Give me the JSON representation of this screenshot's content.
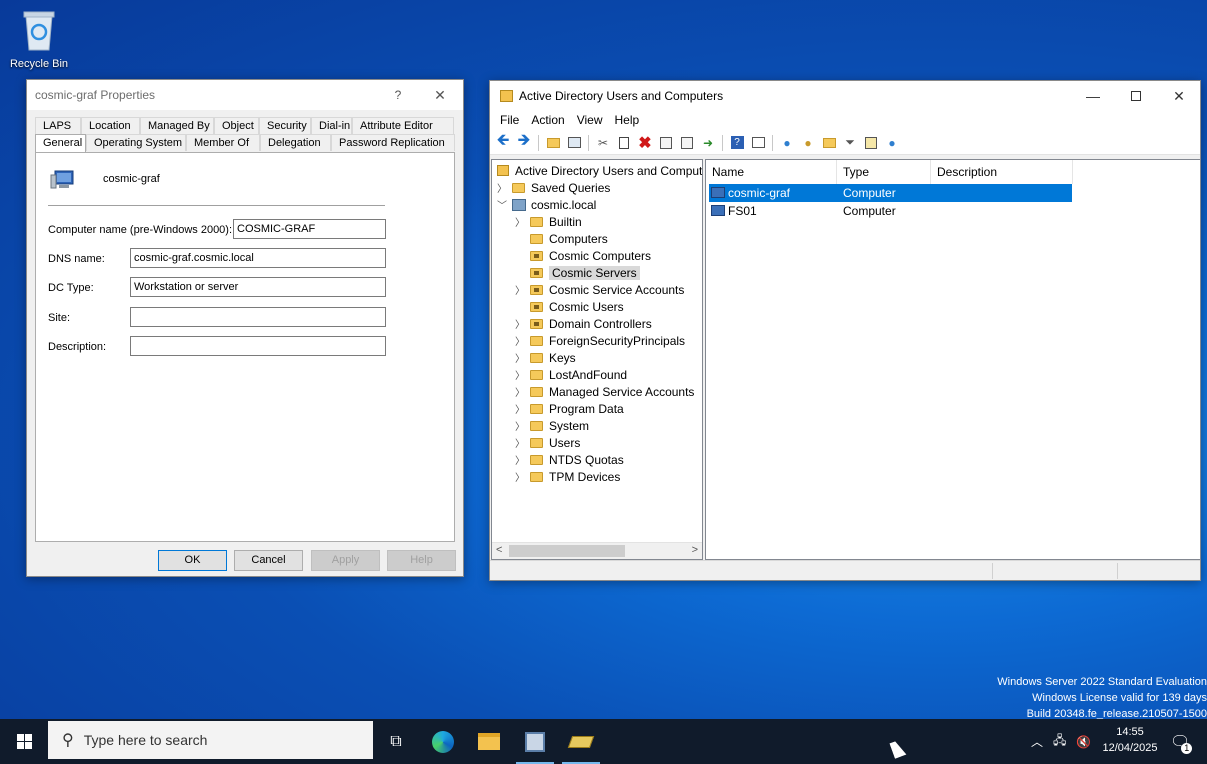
{
  "desktop": {
    "recycle_bin_label": "Recycle Bin",
    "watermark": {
      "line1": "Windows Server 2022 Standard Evaluation",
      "line2": "Windows License valid for 139 days",
      "line3": "Build 20348.fe_release.210507-1500"
    }
  },
  "properties_dialog": {
    "title": "cosmic-graf Properties",
    "help_glyph": "?",
    "tabs_row1": [
      "LAPS",
      "Location",
      "Managed By",
      "Object",
      "Security",
      "Dial-in",
      "Attribute Editor"
    ],
    "tabs_row2": [
      "General",
      "Operating System",
      "Member Of",
      "Delegation",
      "Password Replication"
    ],
    "active_tab": "General",
    "object_name": "cosmic-graf",
    "fields": {
      "computer_name_label": "Computer name (pre-Windows 2000):",
      "computer_name_value": "COSMIC-GRAF",
      "dns_name_label": "DNS name:",
      "dns_name_value": "cosmic-graf.cosmic.local",
      "dc_type_label": "DC Type:",
      "dc_type_value": "Workstation or server",
      "site_label": "Site:",
      "site_value": "",
      "description_label": "Description:",
      "description_value": ""
    },
    "buttons": {
      "ok": "OK",
      "cancel": "Cancel",
      "apply": "Apply",
      "help": "Help"
    }
  },
  "aduc_window": {
    "title": "Active Directory Users and Computers",
    "menu": [
      "File",
      "Action",
      "View",
      "Help"
    ],
    "tree": {
      "root": "Active Directory Users and Computers",
      "saved_queries": "Saved Queries",
      "domain": "cosmic.local",
      "children": [
        {
          "label": "Builtin",
          "expandable": true,
          "ou": false
        },
        {
          "label": "Computers",
          "expandable": false,
          "ou": false
        },
        {
          "label": "Cosmic Computers",
          "expandable": false,
          "ou": true
        },
        {
          "label": "Cosmic Servers",
          "expandable": false,
          "ou": true,
          "selected": true
        },
        {
          "label": "Cosmic Service Accounts",
          "expandable": true,
          "ou": true
        },
        {
          "label": "Cosmic Users",
          "expandable": false,
          "ou": true
        },
        {
          "label": "Domain Controllers",
          "expandable": true,
          "ou": true
        },
        {
          "label": "ForeignSecurityPrincipals",
          "expandable": true,
          "ou": false
        },
        {
          "label": "Keys",
          "expandable": true,
          "ou": false
        },
        {
          "label": "LostAndFound",
          "expandable": true,
          "ou": false
        },
        {
          "label": "Managed Service Accounts",
          "expandable": true,
          "ou": false
        },
        {
          "label": "Program Data",
          "expandable": true,
          "ou": false
        },
        {
          "label": "System",
          "expandable": true,
          "ou": false
        },
        {
          "label": "Users",
          "expandable": true,
          "ou": false
        },
        {
          "label": "NTDS Quotas",
          "expandable": true,
          "ou": false
        },
        {
          "label": "TPM Devices",
          "expandable": true,
          "ou": false
        }
      ]
    },
    "list": {
      "columns": [
        "Name",
        "Type",
        "Description"
      ],
      "rows": [
        {
          "name": "cosmic-graf",
          "type": "Computer",
          "description": "",
          "selected": true
        },
        {
          "name": "FS01",
          "type": "Computer",
          "description": "",
          "selected": false
        }
      ]
    }
  },
  "taskbar": {
    "search_placeholder": "Type here to search",
    "time": "14:55",
    "date": "12/04/2025",
    "notification_count": "1"
  }
}
